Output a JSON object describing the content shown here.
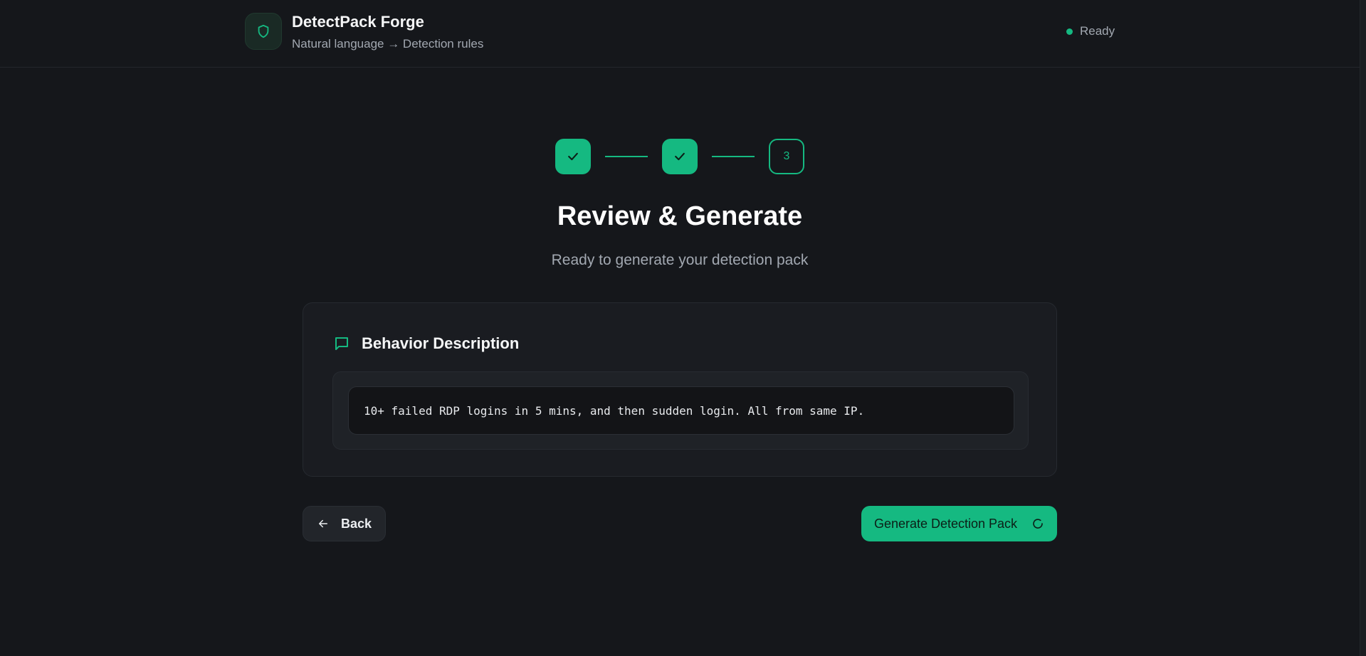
{
  "header": {
    "app_title": "DetectPack Forge",
    "app_subtitle": "Natural language → Detection rules",
    "status_text": "Ready",
    "logo_icon": "shield-icon"
  },
  "colors": {
    "accent": "#15b981",
    "background": "#15171b",
    "card": "#1a1c21"
  },
  "stepper": {
    "steps": [
      {
        "state": "done",
        "icon": "check-icon"
      },
      {
        "state": "done",
        "icon": "check-icon"
      },
      {
        "state": "current",
        "label": "3"
      }
    ]
  },
  "main": {
    "title": "Review & Generate",
    "subtitle": "Ready to generate your detection pack"
  },
  "card": {
    "title": "Behavior Description",
    "icon": "chat-bubble-icon",
    "description": "10+ failed RDP logins in 5 mins, and then sudden login. All from same IP."
  },
  "actions": {
    "back_label": "Back",
    "generate_label": "Generate Detection Pack"
  }
}
